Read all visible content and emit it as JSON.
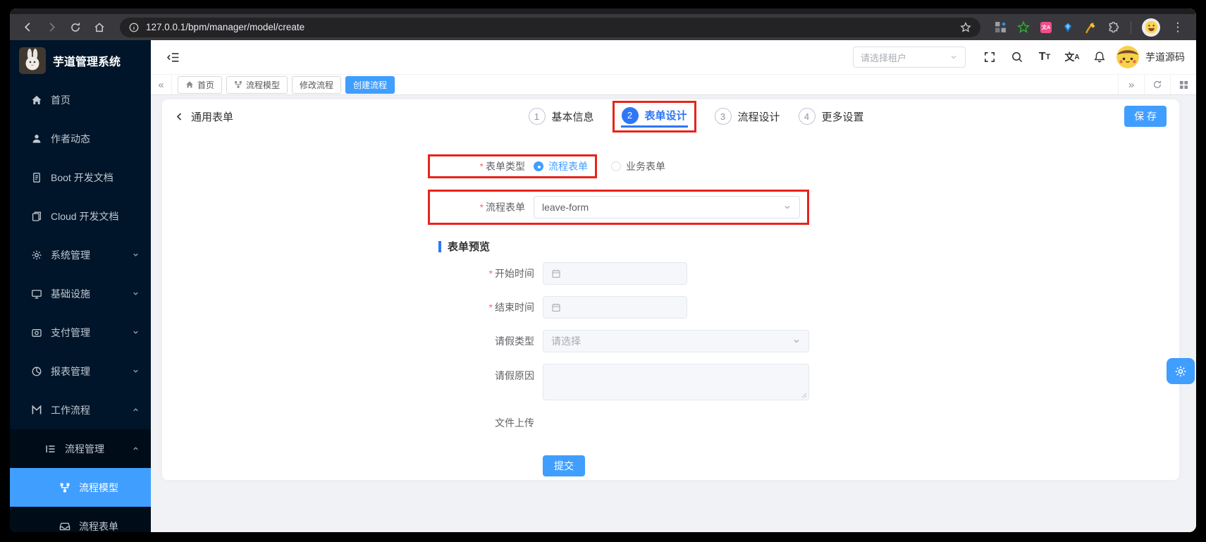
{
  "browser": {
    "url": "127.0.0.1/bpm/manager/model/create"
  },
  "glyphs": {
    "tabs_prev": "«",
    "tabs_next": "»",
    "kebab": "⋮"
  },
  "sidebar": {
    "title": "芋道管理系统",
    "items": [
      {
        "label": "首页"
      },
      {
        "label": "作者动态"
      },
      {
        "label": "Boot 开发文档"
      },
      {
        "label": "Cloud 开发文档"
      },
      {
        "label": "系统管理"
      },
      {
        "label": "基础设施"
      },
      {
        "label": "支付管理"
      },
      {
        "label": "报表管理"
      },
      {
        "label": "工作流程"
      },
      {
        "label": "流程管理"
      },
      {
        "label": "流程模型"
      },
      {
        "label": "流程表单"
      }
    ]
  },
  "navbar": {
    "tenant_placeholder": "请选择租户",
    "size_big": "T",
    "size_small": "T",
    "lang_big": "文",
    "lang_small": "A",
    "username": "芋道源码"
  },
  "tabs": {
    "items": [
      {
        "label": "首页"
      },
      {
        "label": "流程模型"
      },
      {
        "label": "修改流程"
      },
      {
        "label": "创建流程"
      }
    ]
  },
  "page": {
    "back_label": "通用表单",
    "steps": [
      {
        "num": "1",
        "label": "基本信息"
      },
      {
        "num": "2",
        "label": "表单设计"
      },
      {
        "num": "3",
        "label": "流程设计"
      },
      {
        "num": "4",
        "label": "更多设置"
      }
    ],
    "save_label": "保 存"
  },
  "form": {
    "required_marker": "*",
    "type_label": "表单类型",
    "type_options": [
      {
        "label": "流程表单"
      },
      {
        "label": "业务表单"
      }
    ],
    "process_form_label": "流程表单",
    "process_form_value": "leave-form",
    "preview_title": "表单预览",
    "fields": [
      {
        "label": "开始时间"
      },
      {
        "label": "结束时间"
      },
      {
        "label": "请假类型",
        "placeholder": "请选择"
      },
      {
        "label": "请假原因"
      },
      {
        "label": "文件上传"
      }
    ],
    "submit_label": "提交"
  },
  "ext_translate_text": "文A",
  "colors": {
    "primary": "#409eff",
    "step_active": "#2f77f6",
    "annotation_red": "#e8231a",
    "sidebar_bg": "#001529",
    "content_bg": "#f0f2f5"
  }
}
